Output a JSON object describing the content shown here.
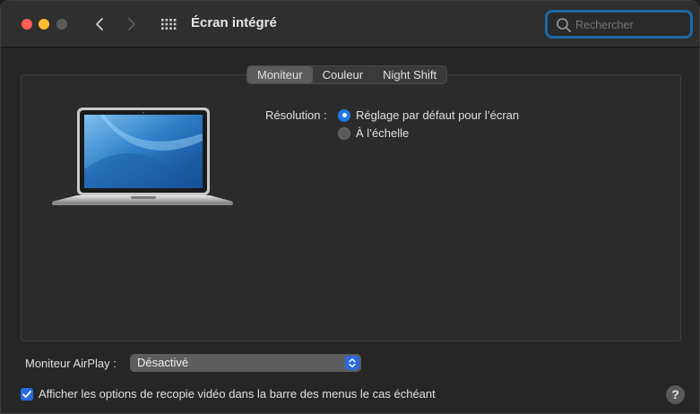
{
  "window": {
    "title": "Écran intégré"
  },
  "search": {
    "placeholder": "Rechercher"
  },
  "tabs": [
    {
      "label": "Moniteur",
      "active": true
    },
    {
      "label": "Couleur",
      "active": false
    },
    {
      "label": "Night Shift",
      "active": false
    }
  ],
  "display": {
    "resolution_label": "Résolution :",
    "options": [
      {
        "label": "Réglage par défaut pour l’écran",
        "selected": true
      },
      {
        "label": "À l’échelle",
        "selected": false
      }
    ]
  },
  "airplay": {
    "label": "Moniteur AirPlay :",
    "selected_value": "Désactivé"
  },
  "mirroring_option": {
    "label": "Afficher les options de recopie vidéo dans la barre des menus le cas échéant",
    "checked": true
  },
  "help": {
    "label": "?"
  },
  "colors": {
    "accent": "#2a6ae0",
    "close": "#fe5f57",
    "minimize": "#febc2e"
  }
}
